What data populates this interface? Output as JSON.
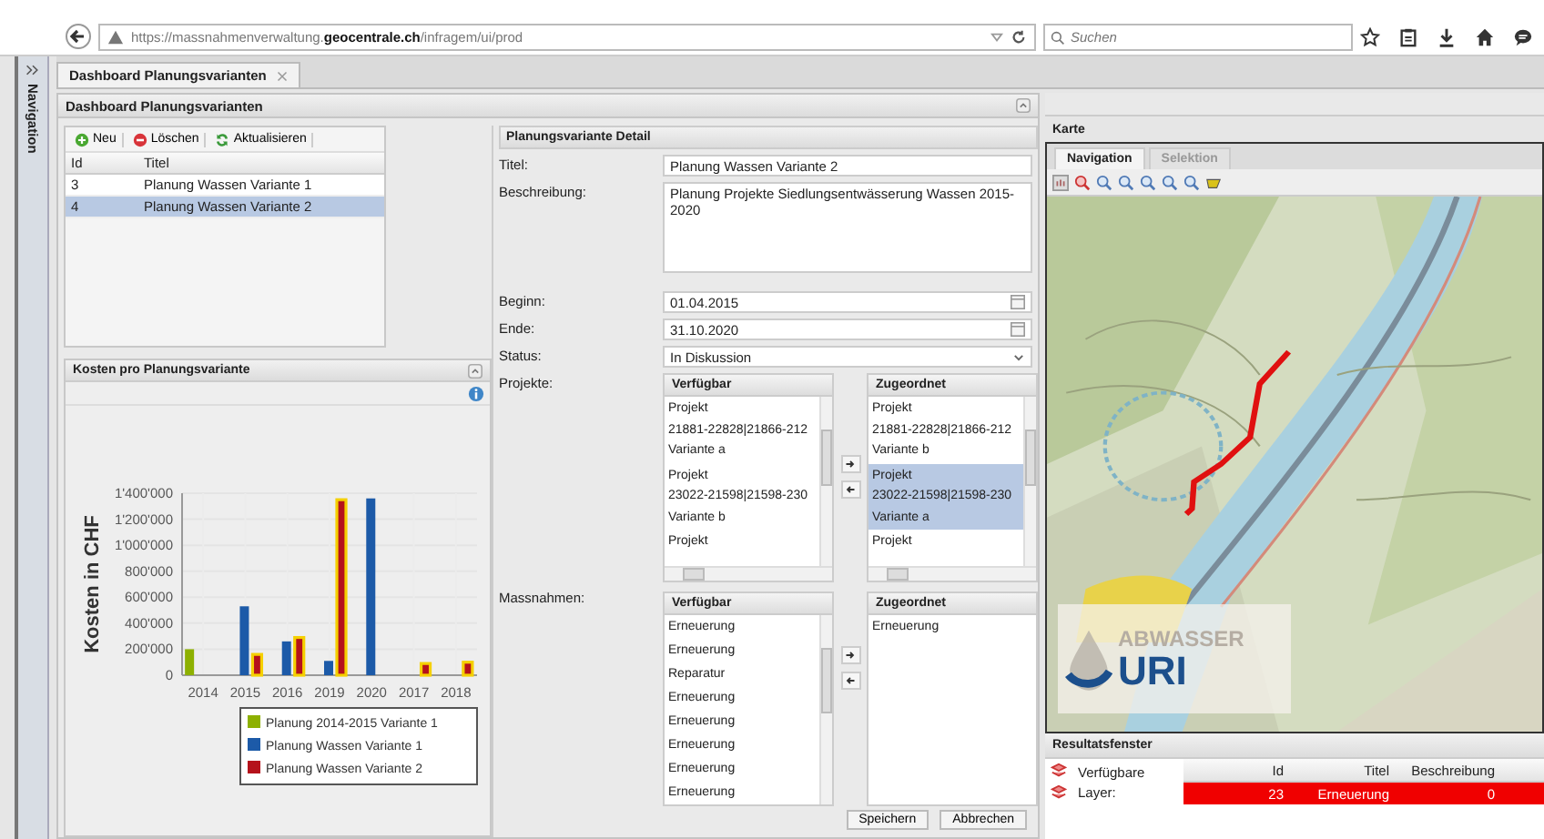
{
  "browser": {
    "url": "https://massnahmenverwaltung.**geocentrale.ch**/infragem/ui/prod",
    "search": {
      "placeholder": "Suchen"
    }
  },
  "sidebar": {
    "label": "Navigation"
  },
  "tabs": [
    {
      "label": "Dashboard Planungsvarianten",
      "selected": true
    }
  ],
  "dashboard": {
    "title": "Dashboard Planungsvarianten",
    "toolbar": [
      {
        "label": "Neu",
        "kind": "add"
      },
      {
        "label": "Löschen",
        "kind": "delete"
      },
      {
        "label": "Aktualisieren",
        "kind": "refresh"
      }
    ],
    "grid": {
      "columns": [
        "Id",
        "Titel"
      ],
      "rows": [
        {
          "id": "3",
          "title": "Planung Wassen Variante 1",
          "selected": false
        },
        {
          "id": "4",
          "title": "Planung Wassen Variante 2",
          "selected": true
        }
      ]
    },
    "chart_panel": {
      "title": "Kosten pro Planungsvariante",
      "chart_data": {
        "type": "bar",
        "ylabel": "Kosten in CHF",
        "categories": [
          "2014",
          "2015",
          "2016",
          "2019",
          "2020",
          "2017",
          "2018"
        ],
        "series": [
          {
            "name": "Planung 2014-2015 Variante 1",
            "color": "#8db000",
            "values": [
              200000,
              null,
              null,
              null,
              null,
              null,
              null
            ]
          },
          {
            "name": "Planung Wassen Variante 1",
            "color": "#1c5aa8",
            "values": [
              null,
              530000,
              260000,
              110000,
              1360000,
              null,
              null
            ]
          },
          {
            "name": "Planung Wassen Variante 2",
            "color": "#b5121b",
            "values": [
              null,
              160000,
              290000,
              1350000,
              null,
              90000,
              100000
            ]
          }
        ],
        "grid": true,
        "legend": true,
        "ylim": [
          0,
          1400000
        ],
        "yticks": [
          {
            "value": 0,
            "label": "0"
          },
          {
            "value": 200000,
            "label": "200'000"
          },
          {
            "value": 400000,
            "label": "400'000"
          },
          {
            "value": 600000,
            "label": "600'000"
          },
          {
            "value": 800000,
            "label": "800'000"
          },
          {
            "value": 1000000,
            "label": "1'000'000"
          },
          {
            "value": 1200000,
            "label": "1'200'000"
          },
          {
            "value": 1400000,
            "label": "1'400'000"
          }
        ]
      }
    },
    "detail": {
      "title": "Planungsvariante Detail",
      "fields": [
        {
          "label": "Titel:",
          "kind": "text",
          "value": "Planung Wassen Variante 2"
        },
        {
          "label": "Beschreibung:",
          "kind": "textarea",
          "value": "Planung Projekte Siedlungsentwässerung Wassen 2015-2020"
        },
        {
          "label": "Beginn:",
          "kind": "date",
          "value": "01.04.2015"
        },
        {
          "label": "Ende:",
          "kind": "date",
          "value": "31.10.2020"
        },
        {
          "label": "Status:",
          "kind": "select",
          "value": "In Diskussion"
        }
      ],
      "pickers": [
        {
          "label": "Projekte:",
          "kind": "projects",
          "available": {
            "title": "Verfügbar",
            "items": [
              {
                "lines": [
                  "Projekt",
                  "21881-22828|21866-212",
                  "Variante a"
                ],
                "selected": false
              },
              {
                "lines": [
                  "Projekt",
                  "23022-21598|21598-230",
                  "Variante b"
                ],
                "selected": false
              },
              {
                "lines": [
                  "Projekt"
                ],
                "selected": false
              }
            ]
          },
          "assigned": {
            "title": "Zugeordnet",
            "items": [
              {
                "lines": [
                  "Projekt",
                  "21881-22828|21866-212",
                  "Variante b"
                ],
                "selected": false
              },
              {
                "lines": [
                  "Projekt",
                  "23022-21598|21598-230",
                  "Variante a"
                ],
                "selected": true
              },
              {
                "lines": [
                  "Projekt"
                ],
                "selected": false
              }
            ]
          }
        },
        {
          "label": "Massnahmen:",
          "kind": "measures",
          "available": {
            "title": "Verfügbar",
            "items": [
              {
                "lines": [
                  "Erneuerung"
                ],
                "selected": false
              },
              {
                "lines": [
                  "Erneuerung"
                ],
                "selected": false
              },
              {
                "lines": [
                  "Reparatur"
                ],
                "selected": false
              },
              {
                "lines": [
                  "Erneuerung"
                ],
                "selected": false
              },
              {
                "lines": [
                  "Erneuerung"
                ],
                "selected": false
              },
              {
                "lines": [
                  "Erneuerung"
                ],
                "selected": false
              },
              {
                "lines": [
                  "Erneuerung"
                ],
                "selected": false
              },
              {
                "lines": [
                  "Erneuerung"
                ],
                "selected": false
              }
            ]
          },
          "assigned": {
            "title": "Zugeordnet",
            "items": [
              {
                "lines": [
                  "Erneuerung"
                ],
                "selected": false
              }
            ]
          }
        }
      ],
      "buttons": [
        "Speichern",
        "Abbrechen"
      ]
    }
  },
  "map_panel": {
    "title": "Karte",
    "tabs": [
      {
        "label": "Navigation",
        "selected": true
      },
      {
        "label": "Selektion",
        "selected": false
      }
    ],
    "logo": {
      "top": "ABWASSER",
      "bottom": "URI"
    }
  },
  "results": {
    "title": "Resultatsfenster",
    "layer_label": "Verfügbare Layer:",
    "columns": [
      "Id",
      "Titel",
      "Beschreibung"
    ],
    "rows": [
      {
        "id": "23",
        "title": "Erneuerung",
        "description": "0",
        "selected": true
      }
    ]
  }
}
